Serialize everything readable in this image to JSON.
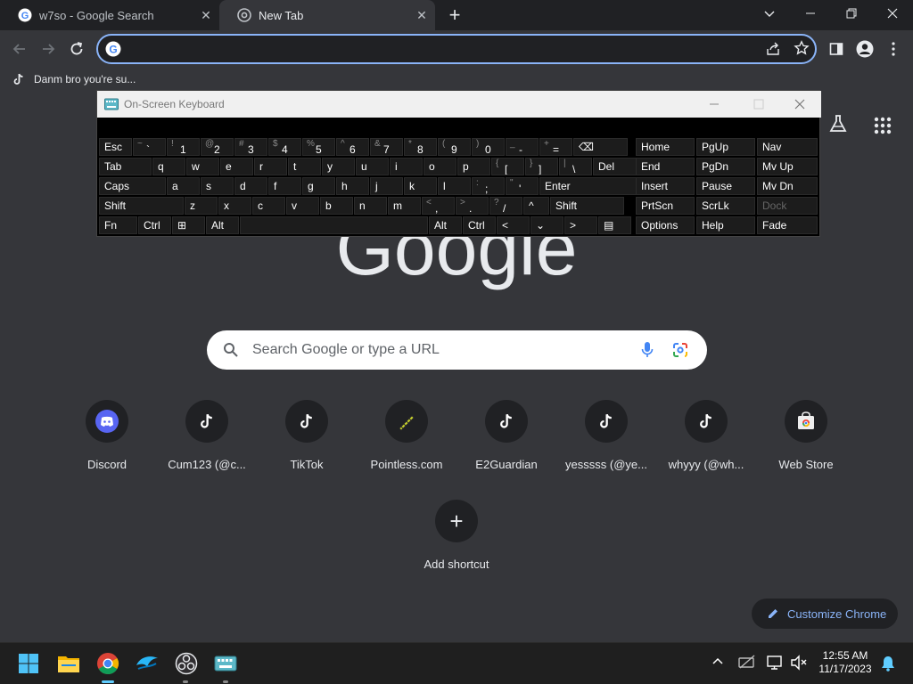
{
  "tabs": [
    {
      "title": "w7so - Google Search"
    },
    {
      "title": "New Tab"
    }
  ],
  "window_controls": {
    "dropdown": "⌄",
    "minimize": "—",
    "restore": "❐",
    "close": "✕"
  },
  "new_tab_glyph": "+",
  "omnibox": {
    "value": "",
    "placeholder": ""
  },
  "bookmarks": [
    {
      "label": "Danm bro you're su..."
    }
  ],
  "osk": {
    "title": "On-Screen Keyboard",
    "rows": [
      [
        {
          "label": "Esc"
        },
        {
          "shift": "~",
          "base": "`"
        },
        {
          "shift": "!",
          "base": "1"
        },
        {
          "shift": "@",
          "base": "2"
        },
        {
          "shift": "#",
          "base": "3"
        },
        {
          "shift": "$",
          "base": "4"
        },
        {
          "shift": "%",
          "base": "5"
        },
        {
          "shift": "^",
          "base": "6"
        },
        {
          "shift": "&",
          "base": "7"
        },
        {
          "shift": "*",
          "base": "8"
        },
        {
          "shift": "(",
          "base": "9"
        },
        {
          "shift": ")",
          "base": "0"
        },
        {
          "shift": "_",
          "base": "-"
        },
        {
          "shift": "+",
          "base": "="
        },
        {
          "label": "⌫"
        }
      ],
      [
        {
          "label": "Tab"
        },
        {
          "label": "q"
        },
        {
          "label": "w"
        },
        {
          "label": "e"
        },
        {
          "label": "r"
        },
        {
          "label": "t"
        },
        {
          "label": "y"
        },
        {
          "label": "u"
        },
        {
          "label": "i"
        },
        {
          "label": "o"
        },
        {
          "label": "p"
        },
        {
          "shift": "{",
          "base": "["
        },
        {
          "shift": "}",
          "base": "]"
        },
        {
          "shift": "|",
          "base": "\\"
        },
        {
          "label": "Del"
        }
      ],
      [
        {
          "label": "Caps"
        },
        {
          "label": "a"
        },
        {
          "label": "s"
        },
        {
          "label": "d"
        },
        {
          "label": "f"
        },
        {
          "label": "g"
        },
        {
          "label": "h"
        },
        {
          "label": "j"
        },
        {
          "label": "k"
        },
        {
          "label": "l"
        },
        {
          "shift": ":",
          "base": ";"
        },
        {
          "shift": "\"",
          "base": "'"
        },
        {
          "label": "Enter"
        }
      ],
      [
        {
          "label": "Shift"
        },
        {
          "label": "z"
        },
        {
          "label": "x"
        },
        {
          "label": "c"
        },
        {
          "label": "v"
        },
        {
          "label": "b"
        },
        {
          "label": "n"
        },
        {
          "label": "m"
        },
        {
          "shift": "<",
          "base": ","
        },
        {
          "shift": ">",
          "base": "."
        },
        {
          "shift": "?",
          "base": "/"
        },
        {
          "label": "^"
        },
        {
          "label": "Shift"
        }
      ],
      [
        {
          "label": "Fn"
        },
        {
          "label": "Ctrl"
        },
        {
          "label": "⊞"
        },
        {
          "label": "Alt"
        },
        {
          "label": ""
        },
        {
          "label": "Alt"
        },
        {
          "label": "Ctrl"
        },
        {
          "label": "<"
        },
        {
          "label": "⌄"
        },
        {
          "label": ">"
        },
        {
          "label": "▤"
        }
      ]
    ],
    "nav_keys": [
      [
        "Home",
        "PgUp",
        "Nav"
      ],
      [
        "End",
        "PgDn",
        "Mv Up"
      ],
      [
        "Insert",
        "Pause",
        "Mv Dn"
      ],
      [
        "PrtScn",
        "ScrLk",
        "Dock"
      ],
      [
        "Options",
        "Help",
        "Fade"
      ]
    ]
  },
  "logo_text": "Google",
  "search": {
    "placeholder": "Search Google or type a URL"
  },
  "shortcuts": [
    {
      "label": "Discord",
      "icon": "discord-icon"
    },
    {
      "label": "Cum123 (@c...",
      "icon": "tiktok-icon"
    },
    {
      "label": "TikTok",
      "icon": "tiktok-icon"
    },
    {
      "label": "Pointless.com",
      "icon": "pencil-icon"
    },
    {
      "label": "E2Guardian",
      "icon": "tiktok-icon"
    },
    {
      "label": "yesssss (@ye...",
      "icon": "tiktok-icon"
    },
    {
      "label": "whyyy (@wh...",
      "icon": "tiktok-icon"
    },
    {
      "label": "Web Store",
      "icon": "web-store-icon"
    }
  ],
  "add_shortcut": {
    "label": "Add shortcut",
    "glyph": "+"
  },
  "customize": {
    "label": "Customize Chrome"
  },
  "taskbar": {
    "apps": [
      "start",
      "file-explorer",
      "chrome",
      "dolphin",
      "obs",
      "on-screen-keyboard"
    ],
    "time": "12:55 AM",
    "date": "11/17/2023"
  }
}
